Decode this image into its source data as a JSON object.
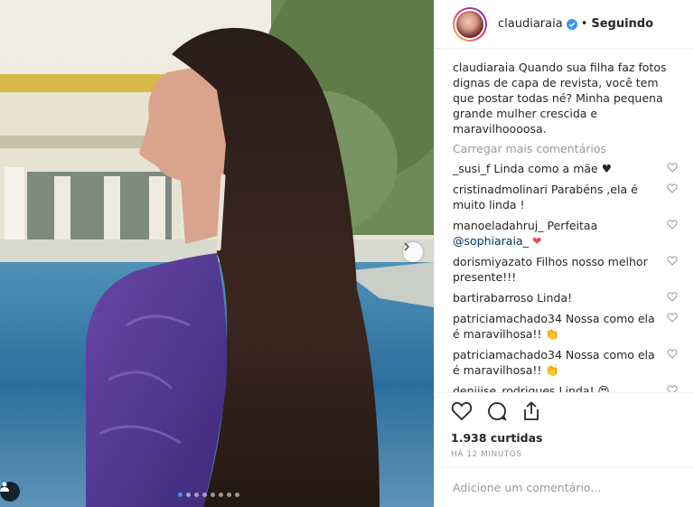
{
  "post": {
    "username": "claudiaraia",
    "follow_status": "Seguindo",
    "separator": "•",
    "caption_user": "claudiaraia",
    "caption_text": "Quando sua filha faz fotos dignas de capa de revista, você tem que postar todas né? Minha pequena grande mulher crescida e maravilhoooosa.",
    "load_more": "Carregar mais comentários",
    "comments": [
      {
        "user": "_susi_f",
        "text": "Linda como a mãe ♥"
      },
      {
        "user": "cristinadmolinari",
        "text": "Parabéns ,ela é muito linda !"
      },
      {
        "user": "manoeladahruj_",
        "text": "Perfeitaa",
        "mention": "@sophiaraia_",
        "emoji": "❤"
      },
      {
        "user": "dorismiyazato",
        "text": "Filhos nosso melhor presente!!!"
      },
      {
        "user": "bartirabarroso",
        "text": "Linda!"
      },
      {
        "user": "patriciamachado34",
        "text": "Nossa como ela é maravilhosa!!",
        "emoji": "👏"
      },
      {
        "user": "patriciamachado34",
        "text": "Nossa como ela é maravilhosa!!",
        "emoji": "👏"
      },
      {
        "user": "deniiise_rodriques",
        "text": "Linda!",
        "emoji": "😍"
      }
    ],
    "likes": "1.938 curtidas",
    "timestamp": "HÁ 12 MINUTOS",
    "add_comment_placeholder": "Adicione um comentário..."
  },
  "carousel": {
    "total": 8,
    "active": 0
  },
  "colors": {
    "accent": "#3897f0",
    "heart": "#ed4956",
    "muted": "#999999"
  }
}
